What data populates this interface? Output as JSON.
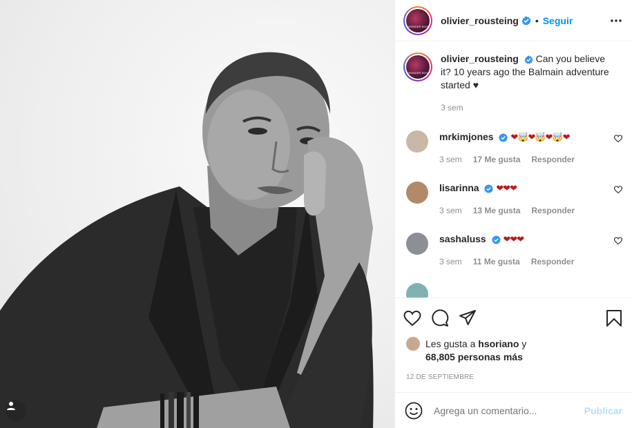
{
  "post": {
    "author": "olivier_rousteing",
    "follow_label": "Seguir",
    "avatar_text": "WONDER BOY",
    "caption": "Can you believe it? 10 years ago the Balmain adventure started ♥",
    "caption_time": "3 sem"
  },
  "comments": [
    {
      "user": "mrkimjones",
      "text": "❤🤯❤🤯❤🤯❤",
      "time": "3 sem",
      "likes": "17 Me gusta",
      "reply": "Responder",
      "avatar_color": "#c9b8a6"
    },
    {
      "user": "lisarinna",
      "text": "❤❤❤",
      "time": "3 sem",
      "likes": "13 Me gusta",
      "reply": "Responder",
      "avatar_color": "#b08a6b"
    },
    {
      "user": "sashaluss",
      "text": "❤❤❤",
      "time": "3 sem",
      "likes": "11 Me gusta",
      "reply": "Responder",
      "avatar_color": "#8c8f96"
    }
  ],
  "likes": {
    "line1_prefix": "Les gusta a",
    "line1_user": "hsoriano",
    "line1_suffix": "y",
    "line2": "68,805 personas más"
  },
  "date": "12 DE SEPTIEMBRE",
  "add_comment": {
    "placeholder": "Agrega un comentario...",
    "publish_label": "Publicar"
  },
  "colors": {
    "accent": "#0095f6",
    "publish_disabled": "#b2dffc",
    "heart_red": "#b71c1c",
    "verified": "#3897f0"
  },
  "icons": [
    "verified-badge-icon",
    "more-options-icon",
    "heart-icon",
    "comment-icon",
    "share-icon",
    "bookmark-icon",
    "emoji-icon",
    "tagged-user-icon"
  ]
}
